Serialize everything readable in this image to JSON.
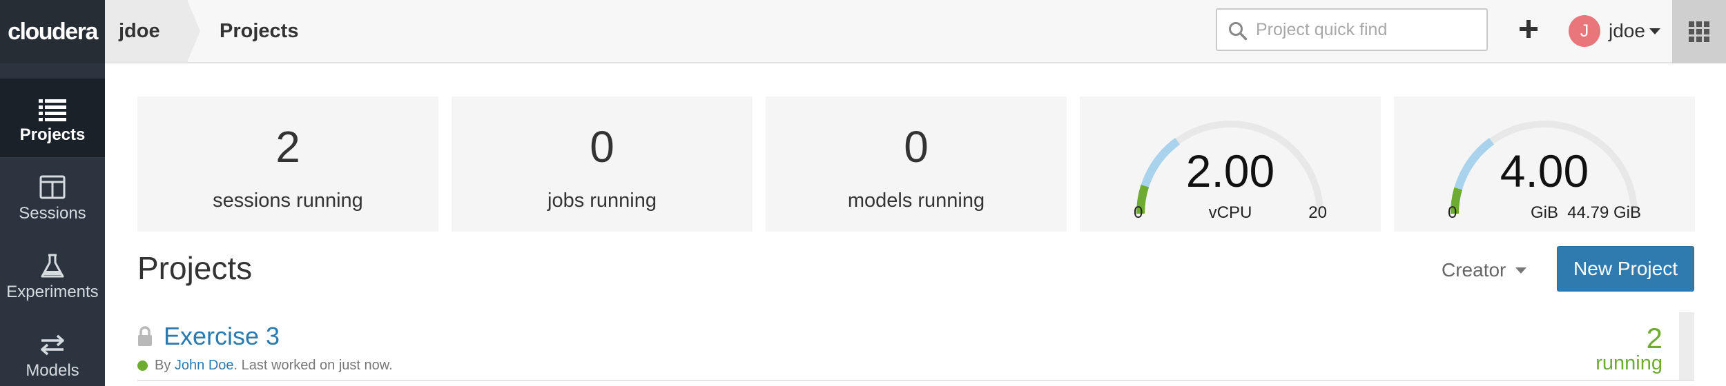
{
  "header": {
    "logo": "cloudera",
    "breadcrumb_user": "jdoe",
    "breadcrumb_page": "Projects",
    "search_placeholder": "Project quick find",
    "add_icon": "plus-icon",
    "avatar_initial": "J",
    "user_name": "jdoe",
    "apps_icon": "apps-grid-icon"
  },
  "sidebar": {
    "items": [
      {
        "label": "Projects",
        "icon": "list-icon",
        "active": true
      },
      {
        "label": "Sessions",
        "icon": "columns-icon",
        "active": false
      },
      {
        "label": "Experiments",
        "icon": "flask-icon",
        "active": false
      },
      {
        "label": "Models",
        "icon": "arrows-icon",
        "active": false
      }
    ]
  },
  "stats": {
    "sessions": {
      "value": "2",
      "label": "sessions running"
    },
    "jobs": {
      "value": "0",
      "label": "jobs running"
    },
    "models": {
      "value": "0",
      "label": "models running"
    }
  },
  "gauges": {
    "cpu": {
      "value": "2.00",
      "unit": "vCPU",
      "min": "0",
      "max": "20",
      "used_fraction": 0.1,
      "allocated_fraction": 0.3
    },
    "memory": {
      "value": "4.00",
      "unit": "GiB",
      "min": "0",
      "max": "44.79 GiB",
      "used_fraction": 0.09,
      "allocated_fraction": 0.3
    }
  },
  "projects_section": {
    "title": "Projects",
    "filter_label": "Creator",
    "new_button": "New Project"
  },
  "projects": [
    {
      "name": "Exercise 3",
      "by_prefix": "By",
      "creator": "John Doe",
      "last_worked": ". Last worked on just now.",
      "running_count": "2",
      "running_label": "running"
    }
  ],
  "colors": {
    "sidebar_bg": "#2c3440",
    "sidebar_active": "#1b2129",
    "primary": "#2f7bb0",
    "success": "#6dab31",
    "gauge_allocated": "#a9d3ec",
    "gauge_track": "#e8e8e8"
  }
}
